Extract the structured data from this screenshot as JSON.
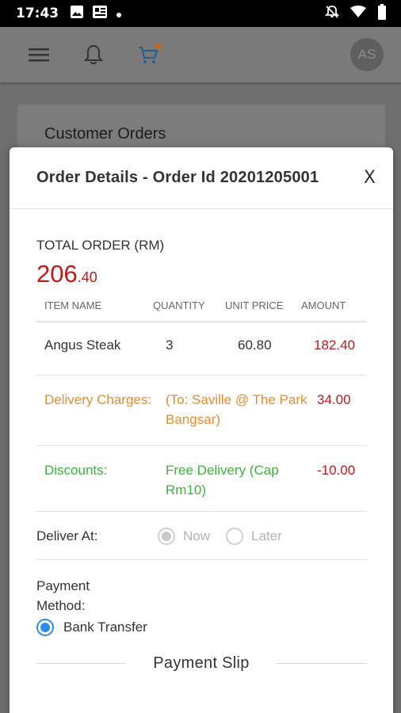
{
  "status_bar": {
    "time": "17:43",
    "icons_left": [
      "image-icon",
      "news-icon",
      "dot-icon"
    ],
    "icons_right": [
      "mute-icon",
      "wifi-icon",
      "battery-icon"
    ]
  },
  "app_bar": {
    "avatar_initials": "AS",
    "icons": [
      "menu-icon",
      "bell-icon",
      "cart-icon"
    ]
  },
  "background_card": {
    "title": "Customer Orders"
  },
  "modal": {
    "title": "Order Details - Order Id 20201205001",
    "close_label": "X",
    "total_label": "TOTAL ORDER (RM)",
    "total_main": "206",
    "total_cents": ".40",
    "columns": [
      "ITEM NAME",
      "QUANTITY",
      "UNIT PRICE",
      "AMOUNT"
    ],
    "items": [
      {
        "name": "Angus Steak",
        "quantity": "3",
        "unit_price": "60.80",
        "amount": "182.40"
      }
    ],
    "delivery": {
      "label": "Delivery Charges:",
      "detail": "(To: Saville @ The Park Bangsar)",
      "amount": "34.00"
    },
    "discount": {
      "label": "Discounts:",
      "detail": "Free Delivery (Cap Rm10)",
      "amount": "-10.00"
    },
    "deliver_at": {
      "label": "Deliver At:",
      "options": [
        "Now",
        "Later"
      ],
      "selected": "Now"
    },
    "payment": {
      "label": "Payment Method:",
      "option": "Bank Transfer"
    },
    "payment_slip_label": "Payment Slip"
  },
  "colors": {
    "total_red": "#c21818",
    "delivery_orange": "#e88a2e",
    "discount_green": "#3db33d",
    "radio_blue": "#2c8be6"
  }
}
